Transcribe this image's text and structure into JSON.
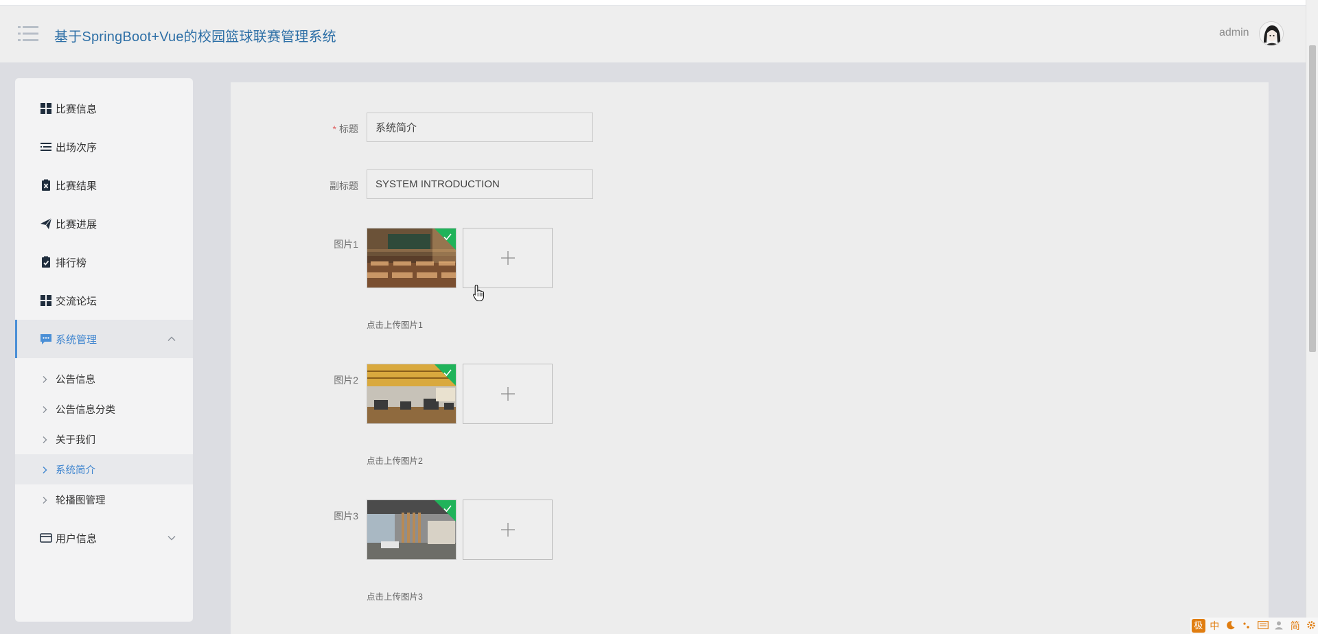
{
  "header": {
    "title": "基于SpringBoot+Vue的校园篮球联赛管理系统",
    "user_name": "admin"
  },
  "sidebar": {
    "items": [
      {
        "label": "比赛信息",
        "icon": "grid-icon"
      },
      {
        "label": "出场次序",
        "icon": "list-icon"
      },
      {
        "label": "比赛结果",
        "icon": "clipboard-x-icon"
      },
      {
        "label": "比赛进展",
        "icon": "paper-plane-icon"
      },
      {
        "label": "排行榜",
        "icon": "clipboard-check-icon"
      },
      {
        "label": "交流论坛",
        "icon": "grid-icon"
      },
      {
        "label": "系统管理",
        "icon": "chat-icon",
        "expanded": true
      },
      {
        "label": "用户信息",
        "icon": "card-icon",
        "expanded": false
      }
    ],
    "system_sub": [
      {
        "label": "公告信息"
      },
      {
        "label": "公告信息分类"
      },
      {
        "label": "关于我们"
      },
      {
        "label": "系统简介",
        "selected": true
      },
      {
        "label": "轮播图管理"
      }
    ]
  },
  "form": {
    "title_label": "标题",
    "title_required": "*",
    "title_value": "系统简介",
    "subtitle_label": "副标题",
    "subtitle_value": "SYSTEM INTRODUCTION",
    "images": [
      {
        "label": "图片1",
        "tip": "点击上传图片1"
      },
      {
        "label": "图片2",
        "tip": "点击上传图片2"
      },
      {
        "label": "图片3",
        "tip": "点击上传图片3"
      }
    ],
    "upload_plus": "+"
  },
  "ime": {
    "items": [
      "中",
      "简"
    ]
  },
  "colors": {
    "accent": "#3d84cf",
    "header_title": "#2d6fa6",
    "success_corner": "#20b35a",
    "ime_orange": "#e07d10"
  }
}
